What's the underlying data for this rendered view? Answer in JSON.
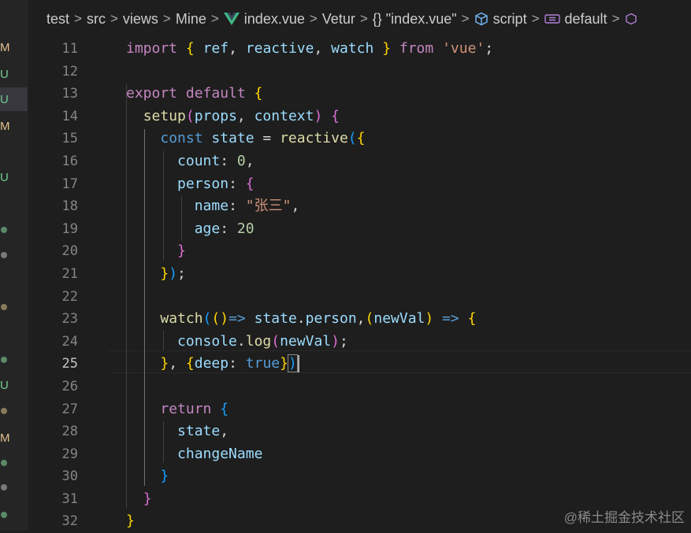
{
  "breadcrumb": {
    "items": [
      "test",
      "src",
      "views",
      "Mine",
      "index.vue",
      "Vetur",
      "{} \"index.vue\"",
      "script",
      "default"
    ],
    "separator": ">"
  },
  "git_gutter": {
    "letters": [
      {
        "text": "M",
        "color": "#e2c08d"
      },
      {
        "text": "U",
        "color": "#73c991"
      },
      {
        "text": "U",
        "color": "#73c991"
      },
      {
        "text": "M",
        "color": "#e2c08d"
      },
      {
        "text": "U",
        "color": "#73c991"
      },
      {
        "text": "U",
        "color": "#73c991"
      },
      {
        "text": "M",
        "color": "#e2c08d"
      }
    ]
  },
  "editor": {
    "line_numbers": [
      "11",
      "12",
      "13",
      "14",
      "15",
      "16",
      "17",
      "18",
      "19",
      "20",
      "21",
      "22",
      "23",
      "24",
      "25",
      "26",
      "27",
      "28",
      "29",
      "30",
      "31",
      "32"
    ],
    "current_line": "25",
    "lines": [
      [
        [
          "kw",
          "import"
        ],
        [
          "pn",
          " "
        ],
        [
          "br1",
          "{"
        ],
        [
          "pn",
          " "
        ],
        [
          "var",
          "ref"
        ],
        [
          "pn",
          ", "
        ],
        [
          "var",
          "reactive"
        ],
        [
          "pn",
          ", "
        ],
        [
          "var",
          "watch"
        ],
        [
          "pn",
          " "
        ],
        [
          "br1",
          "}"
        ],
        [
          "pn",
          " "
        ],
        [
          "kw",
          "from"
        ],
        [
          "pn",
          " "
        ],
        [
          "str",
          "'vue'"
        ],
        [
          "pn",
          ";"
        ]
      ],
      [],
      [
        [
          "kw",
          "export"
        ],
        [
          "pn",
          " "
        ],
        [
          "kw",
          "default"
        ],
        [
          "pn",
          " "
        ],
        [
          "br1",
          "{"
        ]
      ],
      [
        [
          "pn",
          "  "
        ],
        [
          "fn",
          "setup"
        ],
        [
          "br2",
          "("
        ],
        [
          "var",
          "props"
        ],
        [
          "pn",
          ", "
        ],
        [
          "var",
          "context"
        ],
        [
          "br2",
          ")"
        ],
        [
          "pn",
          " "
        ],
        [
          "br2",
          "{"
        ]
      ],
      [
        [
          "pn",
          "    "
        ],
        [
          "decl",
          "const"
        ],
        [
          "pn",
          " "
        ],
        [
          "var",
          "state"
        ],
        [
          "pn",
          " = "
        ],
        [
          "fn",
          "reactive"
        ],
        [
          "br3",
          "("
        ],
        [
          "br1",
          "{"
        ]
      ],
      [
        [
          "pn",
          "      "
        ],
        [
          "var",
          "count"
        ],
        [
          "pn",
          ": "
        ],
        [
          "num",
          "0"
        ],
        [
          "pn",
          ","
        ]
      ],
      [
        [
          "pn",
          "      "
        ],
        [
          "var",
          "person"
        ],
        [
          "pn",
          ": "
        ],
        [
          "br2",
          "{"
        ]
      ],
      [
        [
          "pn",
          "        "
        ],
        [
          "var",
          "name"
        ],
        [
          "pn",
          ": "
        ],
        [
          "str",
          "\"张三\""
        ],
        [
          "pn",
          ","
        ]
      ],
      [
        [
          "pn",
          "        "
        ],
        [
          "var",
          "age"
        ],
        [
          "pn",
          ": "
        ],
        [
          "num",
          "20"
        ]
      ],
      [
        [
          "pn",
          "      "
        ],
        [
          "br2",
          "}"
        ]
      ],
      [
        [
          "pn",
          "    "
        ],
        [
          "br1",
          "}"
        ],
        [
          "br3",
          ")"
        ],
        [
          "pn",
          ";"
        ]
      ],
      [],
      [
        [
          "pn",
          "    "
        ],
        [
          "fn",
          "watch"
        ],
        [
          "br3",
          "("
        ],
        [
          "br1",
          "()"
        ],
        [
          "decl",
          "=>"
        ],
        [
          "pn",
          " "
        ],
        [
          "var",
          "state"
        ],
        [
          "pn",
          "."
        ],
        [
          "var",
          "person"
        ],
        [
          "pn",
          ","
        ],
        [
          "br1",
          "("
        ],
        [
          "var",
          "newVal"
        ],
        [
          "br1",
          ")"
        ],
        [
          "pn",
          " "
        ],
        [
          "decl",
          "=>"
        ],
        [
          "pn",
          " "
        ],
        [
          "br1",
          "{"
        ]
      ],
      [
        [
          "pn",
          "      "
        ],
        [
          "var",
          "console"
        ],
        [
          "pn",
          "."
        ],
        [
          "fn",
          "log"
        ],
        [
          "br2",
          "("
        ],
        [
          "var",
          "newVal"
        ],
        [
          "br2",
          ")"
        ],
        [
          "pn",
          ";"
        ]
      ],
      [
        [
          "pn",
          "    "
        ],
        [
          "br1",
          "}"
        ],
        [
          "pn",
          ", "
        ],
        [
          "br1",
          "{"
        ],
        [
          "var",
          "deep"
        ],
        [
          "pn",
          ": "
        ],
        [
          "decl",
          "true"
        ],
        [
          "br1",
          "}"
        ],
        [
          "br3",
          ")"
        ]
      ],
      [],
      [
        [
          "pn",
          "    "
        ],
        [
          "kw",
          "return"
        ],
        [
          "pn",
          " "
        ],
        [
          "br3",
          "{"
        ]
      ],
      [
        [
          "pn",
          "      "
        ],
        [
          "var",
          "state"
        ],
        [
          "pn",
          ","
        ]
      ],
      [
        [
          "pn",
          "      "
        ],
        [
          "var",
          "changeName"
        ]
      ],
      [
        [
          "pn",
          "    "
        ],
        [
          "br3",
          "}"
        ]
      ],
      [
        [
          "pn",
          "  "
        ],
        [
          "br2",
          "}"
        ]
      ],
      [
        [
          "br1",
          "}"
        ]
      ]
    ]
  },
  "watermark": "@稀土掘金技术社区"
}
